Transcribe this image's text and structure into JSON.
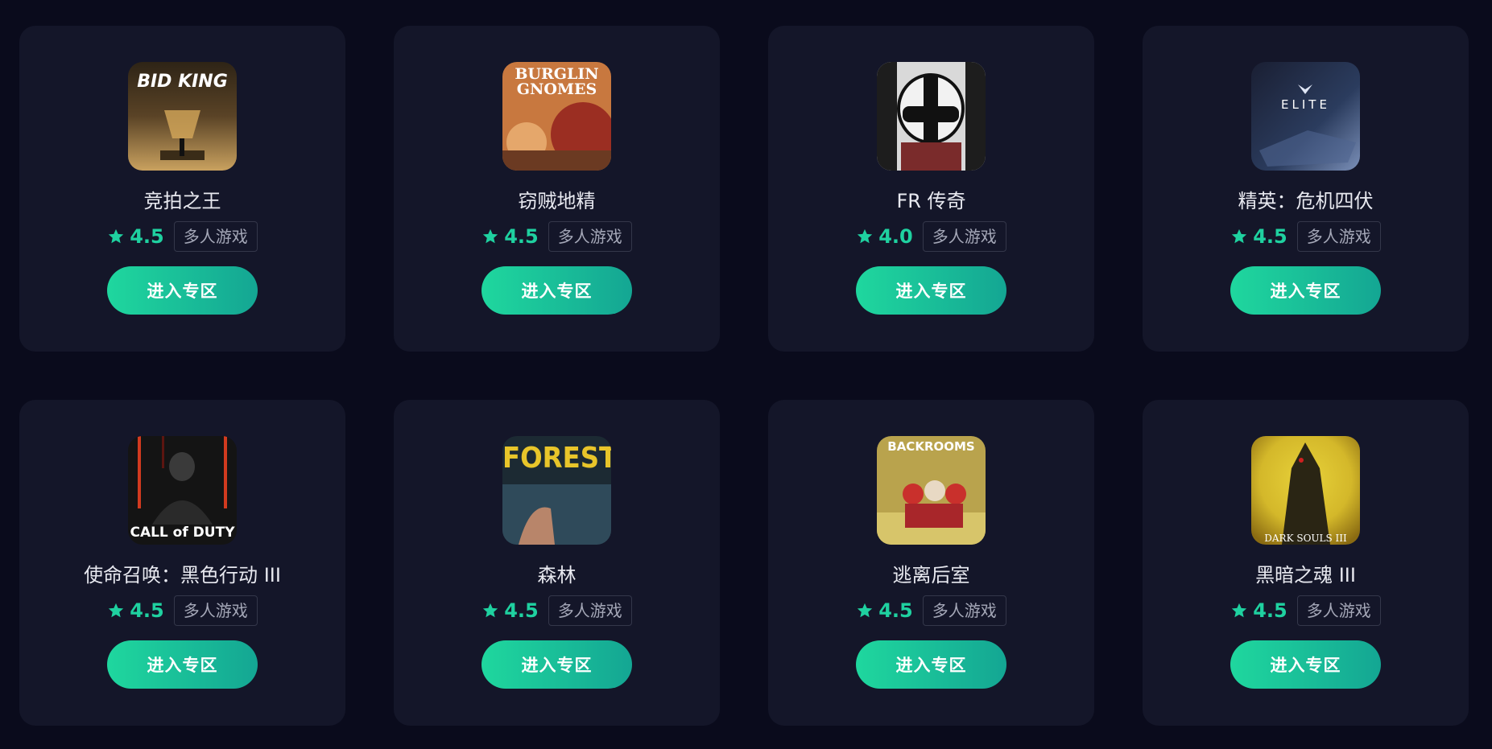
{
  "cards": [
    {
      "name": "竞拍之王",
      "rating": "4.5",
      "tag": "多人游戏",
      "button": "进入专区",
      "cover_text": "BID KING",
      "cover_colors": [
        "#5a4326",
        "#c9a15f",
        "#2e2416"
      ]
    },
    {
      "name": "窃贼地精",
      "rating": "4.5",
      "tag": "多人游戏",
      "button": "进入专区",
      "cover_text": "BURGLIN GNOMES",
      "cover_colors": [
        "#c8783f",
        "#e5a76b",
        "#9b2e22"
      ]
    },
    {
      "name": "FR 传奇",
      "rating": "4.0",
      "tag": "多人游戏",
      "button": "进入专区",
      "cover_text": "",
      "cover_colors": [
        "#1d1d1d",
        "#e8e8e8",
        "#7a2b2b"
      ]
    },
    {
      "name": "精英：危机四伏",
      "rating": "4.5",
      "tag": "多人游戏",
      "button": "进入专区",
      "cover_text": "ELITE",
      "cover_colors": [
        "#2b3c5e",
        "#7a8fb8",
        "#1a1f33"
      ]
    },
    {
      "name": "使命召唤：黑色行动 III",
      "rating": "4.5",
      "tag": "多人游戏",
      "button": "进入专区",
      "cover_text": "CALL of DUTY",
      "cover_colors": [
        "#141414",
        "#5c1510",
        "#d23a1f"
      ]
    },
    {
      "name": "森林",
      "rating": "4.5",
      "tag": "多人游戏",
      "button": "进入专区",
      "cover_text": "FOREST",
      "cover_colors": [
        "#1c2a33",
        "#2f4a5a",
        "#e8c52a"
      ]
    },
    {
      "name": "逃离后室",
      "rating": "4.5",
      "tag": "多人游戏",
      "button": "进入专区",
      "cover_text": "BACKROOMS",
      "cover_colors": [
        "#b9a34d",
        "#d7c56a",
        "#c9302c"
      ]
    },
    {
      "name": "黑暗之魂 III",
      "rating": "4.5",
      "tag": "多人游戏",
      "button": "进入专区",
      "cover_text": "DARK SOULS III",
      "cover_colors": [
        "#d4b82a",
        "#8a6b12",
        "#2a2514"
      ]
    }
  ],
  "icons": {
    "rating": "star-icon"
  },
  "colors": {
    "page_bg": "#0a0b1c",
    "card_bg": "#141629",
    "accent": "#1fd1a0"
  }
}
